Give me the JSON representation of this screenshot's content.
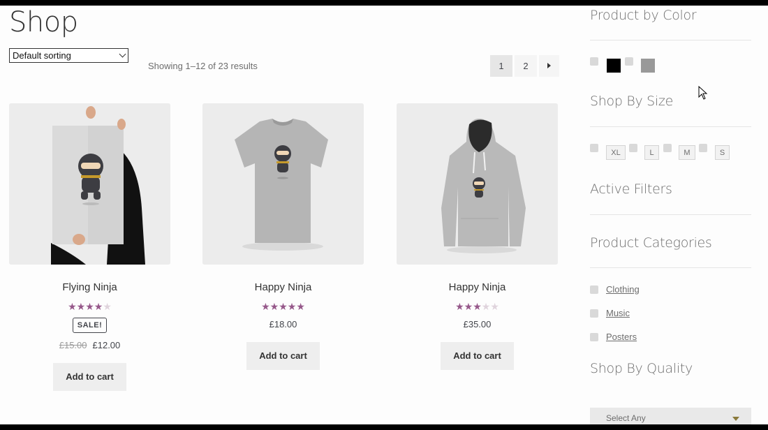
{
  "page": {
    "title": "Shop"
  },
  "toolbar": {
    "sorting_selected": "Default sorting",
    "result_count": "Showing 1–12 of 23 results"
  },
  "pagination": {
    "pages": [
      "1",
      "2"
    ],
    "current": "1",
    "next_icon": "arrow-right-icon"
  },
  "products": [
    {
      "title": "Flying Ninja",
      "rating": 4,
      "rating_max": 5,
      "sale_badge": "SALE!",
      "old_price": "£15.00",
      "price": "£12.00",
      "button": "Add to cart",
      "image": "poster-image"
    },
    {
      "title": "Happy Ninja",
      "rating": 5,
      "rating_max": 5,
      "price": "£18.00",
      "button": "Add to cart",
      "image": "tshirt-image"
    },
    {
      "title": "Happy Ninja",
      "rating": 3,
      "rating_max": 5,
      "price": "£35.00",
      "button": "Add to cart",
      "image": "hoodie-image"
    }
  ],
  "sidebar": {
    "color_widget": {
      "title": "Product by Color",
      "swatches": [
        "#000000",
        "#999999"
      ]
    },
    "size_widget": {
      "title": "Shop By Size",
      "sizes": [
        "XL",
        "L",
        "M",
        "S"
      ]
    },
    "active_filters": {
      "title": "Active Filters"
    },
    "categories": {
      "title": "Product Categories",
      "items": [
        "Clothing",
        "Music",
        "Posters"
      ]
    },
    "quality": {
      "title": "Shop By Quality",
      "select_placeholder": "Select Any"
    }
  },
  "colors": {
    "star": "#96588a",
    "star_empty": "#e0d4dd"
  }
}
